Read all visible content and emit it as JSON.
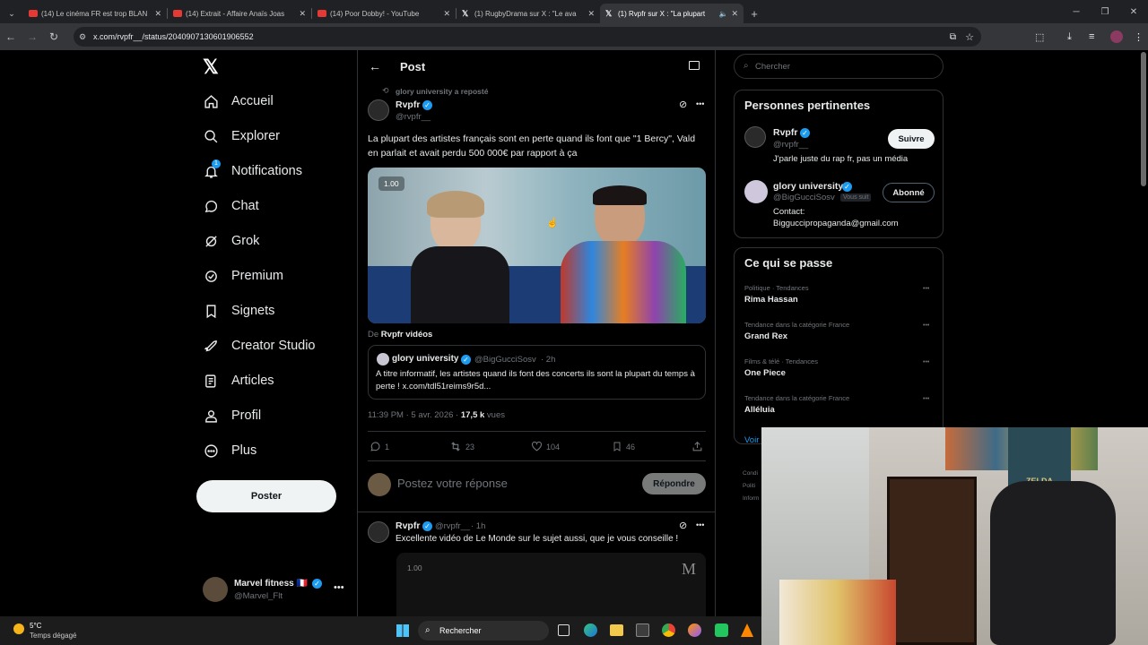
{
  "browser": {
    "tabs": [
      {
        "title": "(14) Le cinéma FR est trop BLAN",
        "icon": "youtube-icon"
      },
      {
        "title": "(14) Extrait - Affaire Anaïs Joas",
        "icon": "youtube-icon"
      },
      {
        "title": "(14) Poor Dobby! - YouTube",
        "icon": "youtube-icon"
      },
      {
        "title": "(1) RugbyDrama sur X : \"Le ava",
        "icon": "x-icon"
      },
      {
        "title": "(1) Rvpfr sur X : \"La plupart",
        "icon": "x-icon"
      }
    ],
    "url": "x.com/rvpfr__/status/2040907130601906552"
  },
  "sidebar": {
    "items": [
      {
        "label": "Accueil",
        "icon": "home-icon"
      },
      {
        "label": "Explorer",
        "icon": "search-icon"
      },
      {
        "label": "Notifications",
        "icon": "bell-icon",
        "badge": "1"
      },
      {
        "label": "Chat",
        "icon": "chat-icon"
      },
      {
        "label": "Grok",
        "icon": "grok-icon"
      },
      {
        "label": "Premium",
        "icon": "premium-icon"
      },
      {
        "label": "Signets",
        "icon": "bookmark-icon"
      },
      {
        "label": "Creator Studio",
        "icon": "rocket-icon"
      },
      {
        "label": "Articles",
        "icon": "articles-icon"
      },
      {
        "label": "Profil",
        "icon": "person-icon"
      },
      {
        "label": "Plus",
        "icon": "more-circle-icon"
      }
    ],
    "post_button": "Poster",
    "account": {
      "name": "Marvel fitness 🇫🇷",
      "handle": "@Marvel_Flt"
    }
  },
  "post_header": {
    "title": "Post"
  },
  "post": {
    "reposted_by": "glory university a reposté",
    "author": "Rvpfr",
    "handle": "@rvpfr__",
    "text": "La plupart des artistes français sont en perte quand ils font que \"1 Bercy\", Vald en parlait et avait perdu 500 000€ par rapport à ça",
    "video_speed": "1.00",
    "video_source_prefix": "De",
    "video_source": "Rvpfr vidéos",
    "quote": {
      "author": "glory university",
      "handle": "@BigGucciSosv",
      "time": "· 2h",
      "text": "A titre informatif, les artistes quand ils font des concerts ils sont la plupart du temps à perte ! x.com/tdl51reims9r5d..."
    },
    "timestamp": "11:39 PM · 5 avr. 2026 ·",
    "views_count": "17,5 k",
    "views_label": "vues",
    "stats": {
      "replies": "1",
      "reposts": "23",
      "likes": "104",
      "bookmarks": "46"
    }
  },
  "reply_box": {
    "placeholder": "Postez votre réponse",
    "button": "Répondre"
  },
  "reply": {
    "author": "Rvpfr",
    "handle": "@rvpfr__",
    "time": "· 1h",
    "text": "Excellente vidéo de Le Monde sur le sujet aussi, que je vous conseille !",
    "video_speed": "1.00",
    "video_logo": "M"
  },
  "search": {
    "placeholder": "Chercher"
  },
  "relevant": {
    "title": "Personnes pertinentes",
    "people": [
      {
        "name": "Rvpfr",
        "handle": "@rvpfr__",
        "bio": "J'parle juste du rap fr, pas un média",
        "button": "Suivre"
      },
      {
        "name": "glory university",
        "handle": "@BigGucciSosv",
        "follows_you": "Vous suit",
        "bio_label": "Contact:",
        "bio": "Bigguccipropaganda@gmail.com",
        "button": "Abonné"
      }
    ]
  },
  "trends": {
    "title": "Ce qui se passe",
    "items": [
      {
        "context": "Politique · Tendances",
        "name": "Rima Hassan"
      },
      {
        "context": "Tendance dans la catégorie France",
        "name": "Grand Rex"
      },
      {
        "context": "Films & télé · Tendances",
        "name": "One Piece"
      },
      {
        "context": "Tendance dans la catégorie France",
        "name": "Alléluia"
      }
    ],
    "more": "Voir"
  },
  "footer_links": [
    "Condi",
    "Politi",
    "Inform"
  ],
  "taskbar": {
    "weather_temp": "5°C",
    "weather_desc": "Temps dégagé",
    "search_placeholder": "Rechercher"
  },
  "webcam": {
    "poster_text": "ZELDA"
  }
}
